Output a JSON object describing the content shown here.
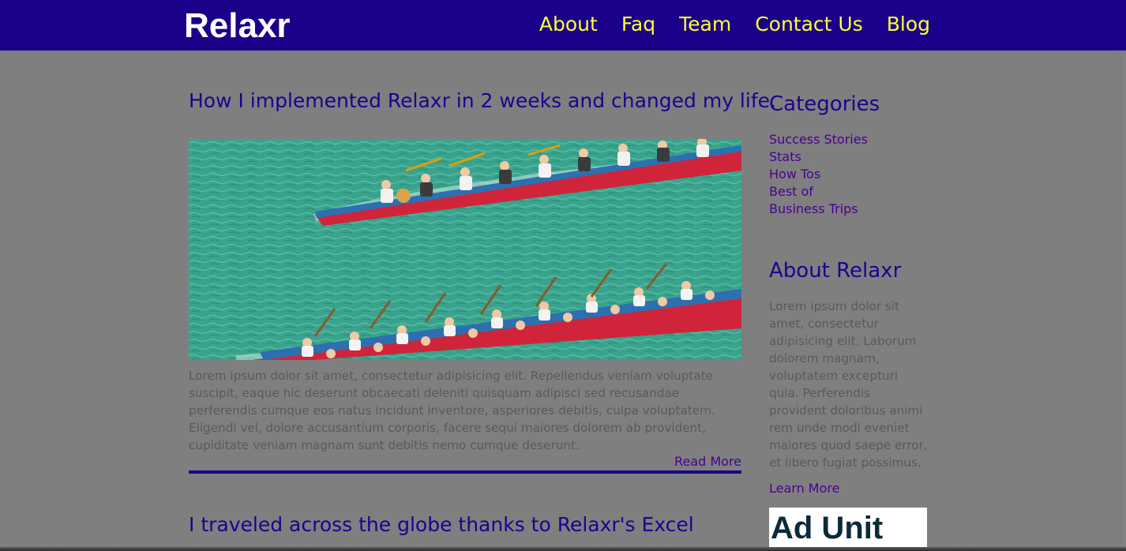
{
  "nav": {
    "logo": "Relaxr",
    "links": [
      "About",
      "Faq",
      "Team",
      "Contact Us",
      "Blog"
    ]
  },
  "posts": [
    {
      "title": "How I implemented Relaxr in 2 weeks and changed my life.",
      "image_alt": "dragon-boat-race-photo",
      "body": "Lorem ipsum dolor sit amet, consectetur adipisicing elit. Repellendus veniam voluptate suscipit, eaque hic deserunt obcaecati deleniti quisquam adipisci sed recusandae perferendis cumque eos natus incidunt inventore, asperiores debitis, culpa voluptatem. Eligendi vel, dolore accusantium corporis, facere sequi maiores dolorem ab provident, cupiditate veniam magnam sunt debitis nemo cumque deserunt.",
      "read_more": "Read More"
    },
    {
      "title": "I traveled across the globe thanks to Relaxr's Excel"
    }
  ],
  "sidebar": {
    "categories_heading": "Categories",
    "categories": [
      "Success Stories",
      "Stats",
      "How Tos",
      "Best of",
      "Business Trips"
    ],
    "about_heading": "About Relaxr",
    "about_text": "Lorem ipsum dolor sit amet, consectetur adipisicing elit. Laborum dolorem magnam, voluptatem excepturi quia. Perferendis provident doloribus animi rem unde modi eveniet maiores quod saepe error, et libero fugiat possimus.",
    "learn_more": "Learn More",
    "ad_label": "Ad Unit"
  },
  "colors": {
    "navbar": "#1b0089",
    "nav_link": "#ffff33",
    "heading": "#1f0090",
    "link": "#4a0090",
    "overlay_background": "#7f7f7f"
  }
}
